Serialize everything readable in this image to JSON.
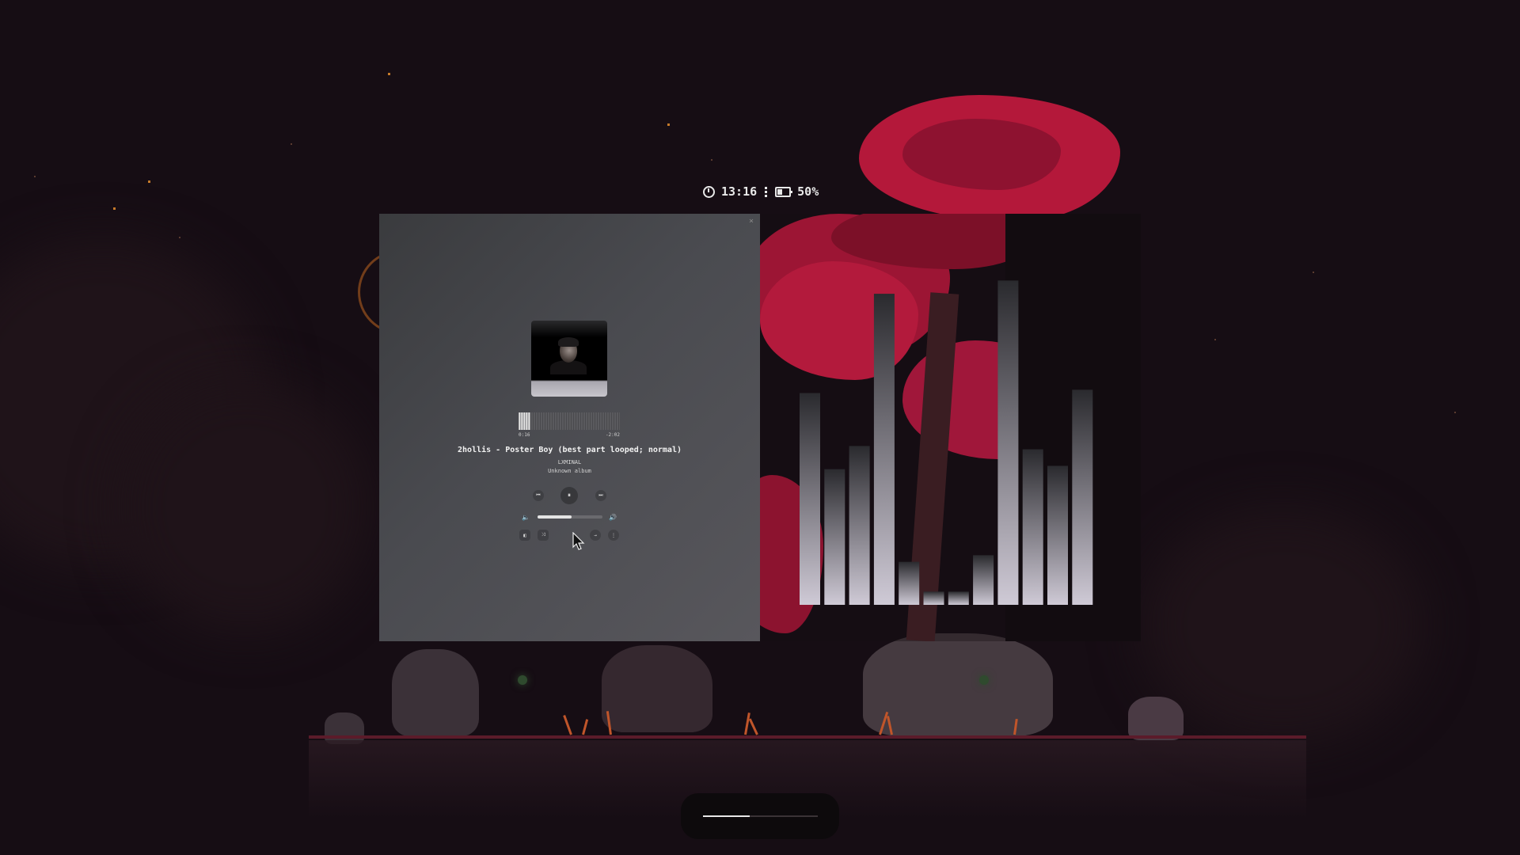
{
  "status_bar": {
    "time": "13:16",
    "battery": "50%"
  },
  "player": {
    "close_glyph": "×",
    "cover_icon": "album-cover-portrait",
    "progress": {
      "elapsed": "0:16",
      "remaining": "-2:02",
      "fraction": 0.117
    },
    "title": "2hollis - Poster Boy (best part looped; normal)",
    "artist": "LXMINAL",
    "album": "Unknown album",
    "controls": {
      "previous": "⏮",
      "play_pause": "⏸",
      "next": "⏭"
    },
    "volume": {
      "low_icon": "🔈",
      "high_icon": "🔊",
      "fraction": 0.52
    },
    "options": {
      "sidebar": "◧",
      "shuffle": "⤨",
      "repeat": "→",
      "more": "⋮"
    }
  },
  "visualizer": {
    "levels": [
      0.64,
      0.41,
      0.48,
      0.94,
      0.13,
      0.04,
      0.04,
      0.15,
      0.98,
      0.47,
      0.42,
      0.65
    ],
    "bar_top_color": "#2a2a2e",
    "bar_bottom_color": "#cfcad6"
  },
  "bottom_pill": {
    "progress_fraction": 0.41
  },
  "colors": {
    "accent": "#c0213f",
    "background": "#160d14"
  }
}
